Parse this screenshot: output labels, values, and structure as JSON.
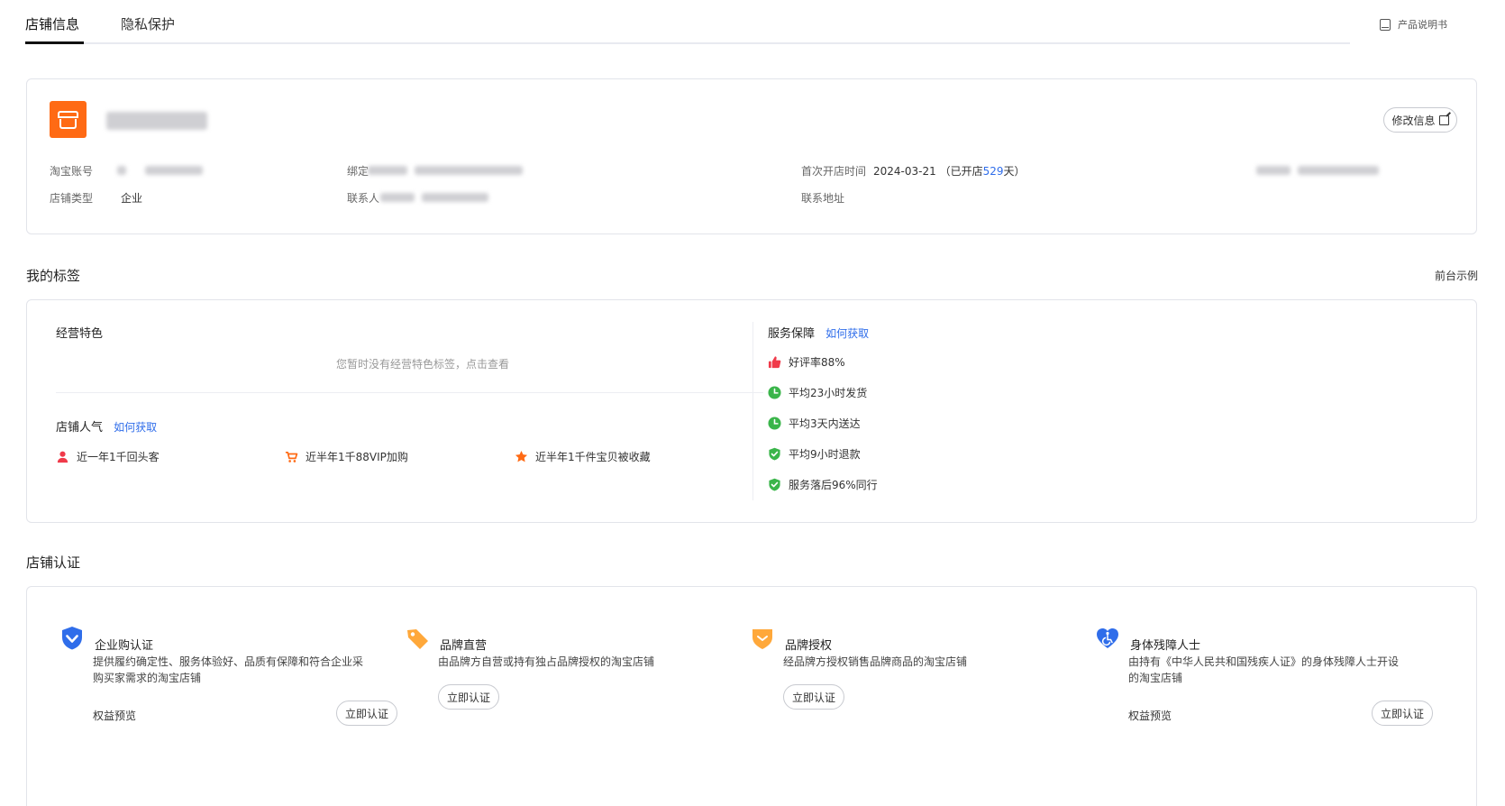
{
  "tabs": [
    {
      "label": "店铺信息",
      "active": true
    },
    {
      "label": "隐私保护",
      "active": false
    }
  ],
  "manual_link": "产品说明书",
  "shop_info": {
    "edit_button": "修改信息",
    "account_label": "淘宝账号",
    "bind_label": "绑定",
    "open_time_label": "首次开店时间",
    "open_date": "2024-03-21",
    "opened_prefix": "（已开店",
    "opened_days": "529",
    "opened_suffix": "天）",
    "shop_type_label": "店铺类型",
    "shop_type_value": "企业",
    "contact_label": "联系人",
    "address_label": "联系地址"
  },
  "tags_section": {
    "title": "我的标签",
    "preview_link": "前台示例",
    "features_title": "经营特色",
    "features_empty": "您暂时没有经营特色标签，点击查看",
    "popularity_title": "店铺人气",
    "how_to_get": "如何获取",
    "popularity_items": [
      {
        "icon": "user-icon",
        "label": "近一年1千回头客"
      },
      {
        "icon": "cart-icon",
        "label": "近半年1千88VIP加购"
      },
      {
        "icon": "star-icon",
        "label": "近半年1千件宝贝被收藏"
      }
    ],
    "service_title": "服务保障",
    "service_how_to_get": "如何获取",
    "service_items": [
      {
        "icon": "thumbs-up-icon",
        "label": "好评率88%"
      },
      {
        "icon": "clock-icon",
        "label": "平均23小时发货"
      },
      {
        "icon": "clock-icon",
        "label": "平均3天内送达"
      },
      {
        "icon": "shield-check-icon",
        "label": "平均9小时退款"
      },
      {
        "icon": "shield-check-icon",
        "label": "服务落后96%同行"
      }
    ]
  },
  "cert_section": {
    "title": "店铺认证",
    "items": [
      {
        "icon": "enterprise-shield-icon",
        "name": "企业购认证",
        "desc": "提供履约确定性、服务体验好、品质有保障和符合企业采购买家需求的淘宝店铺",
        "preview": "权益预览",
        "button": "立即认证"
      },
      {
        "icon": "brand-tag-icon",
        "name": "品牌直营",
        "desc": "由品牌方自营或持有独占品牌授权的淘宝店铺",
        "preview": "",
        "button": "立即认证"
      },
      {
        "icon": "brand-auth-icon",
        "name": "品牌授权",
        "desc": "经品牌方授权销售品牌商品的淘宝店铺",
        "preview": "",
        "button": "立即认证"
      },
      {
        "icon": "accessibility-heart-icon",
        "name": "身体残障人士",
        "desc": "由持有《中华人民共和国残疾人证》的身体残障人士开设的淘宝店铺",
        "preview": "权益预览",
        "button": "立即认证"
      }
    ]
  },
  "colors": {
    "accent_blue": "#2f6dea",
    "logo_orange": "#ff6a14",
    "service_green": "#3ab54a",
    "thumb_red": "#f03a4a"
  }
}
